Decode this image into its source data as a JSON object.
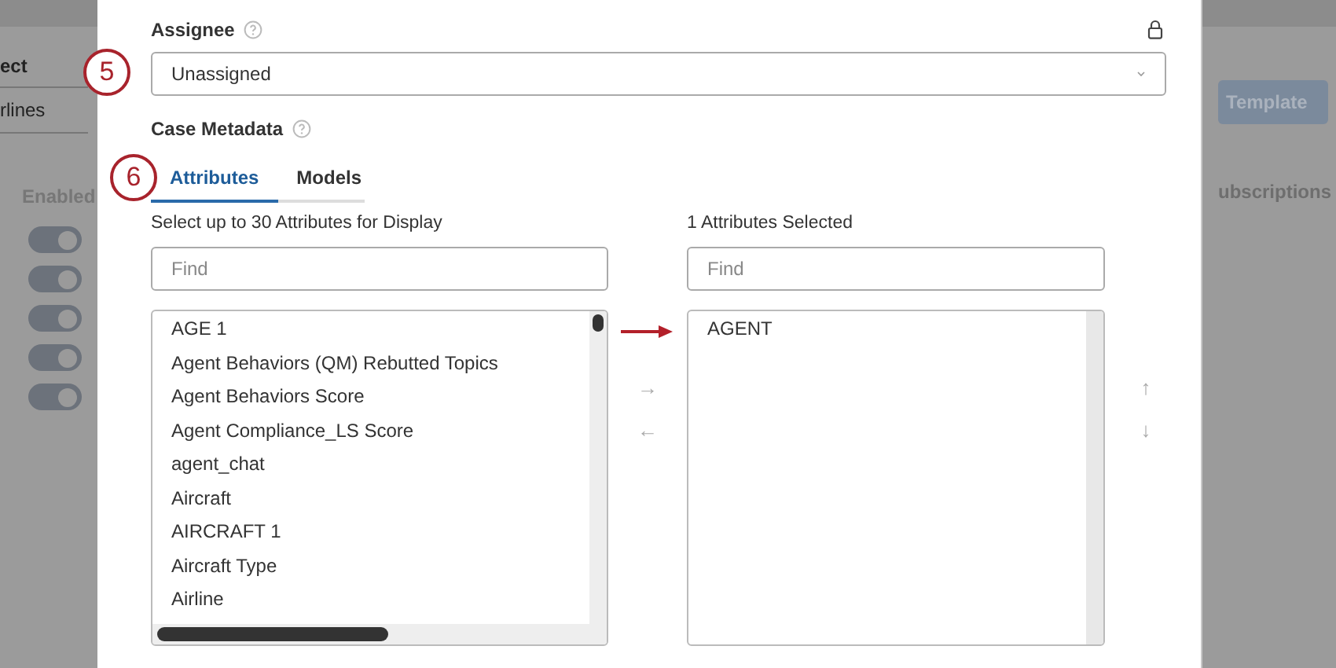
{
  "background": {
    "left": {
      "column_header": "ect",
      "cell": "rlines",
      "enabled_header": "Enabled",
      "toggles": [
        {
          "on": true
        },
        {
          "on": true
        },
        {
          "on": true
        },
        {
          "on": true
        },
        {
          "on": true
        }
      ]
    },
    "right": {
      "button": "Template",
      "column_header": "ubscriptions"
    }
  },
  "assignee": {
    "label": "Assignee",
    "value": "Unassigned"
  },
  "case_metadata": {
    "label": "Case Metadata",
    "tabs": [
      {
        "label": "Attributes",
        "selected": true
      },
      {
        "label": "Models",
        "selected": false
      }
    ]
  },
  "available": {
    "heading": "Select up to 30 Attributes for Display",
    "search": {
      "placeholder": "Find"
    },
    "items": [
      "AGE 1",
      "Agent Behaviors (QM) Rebutted Topics",
      "Agent Behaviors Score",
      "Agent Compliance_LS Score",
      "agent_chat",
      "Aircraft",
      "AIRCRAFT 1",
      "Aircraft Type",
      "Airline"
    ]
  },
  "move_buttons": [
    "→",
    "←"
  ],
  "chosen": {
    "heading": "1 Attributes Selected",
    "search": {
      "placeholder": "Find"
    },
    "items": [
      "AGENT"
    ]
  },
  "order_buttons": [
    "↑",
    "↓"
  ],
  "callouts": [
    "5",
    "6"
  ]
}
